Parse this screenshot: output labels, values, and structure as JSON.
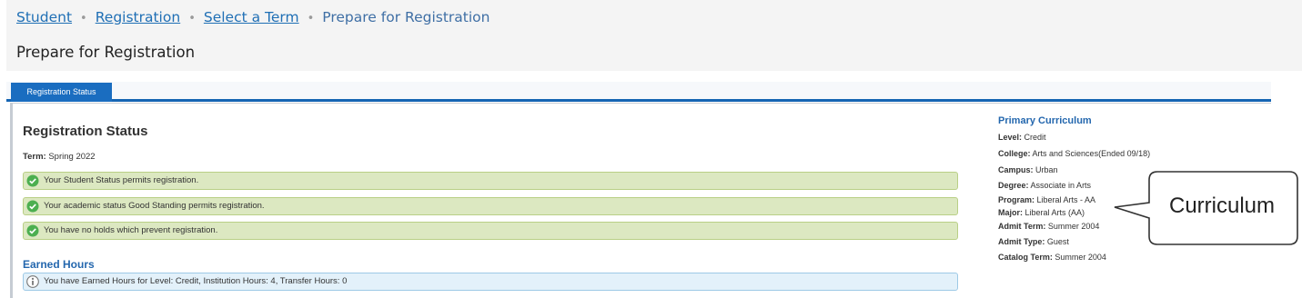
{
  "breadcrumb": {
    "items": [
      "Student",
      "Registration",
      "Select a Term"
    ],
    "separator": "•",
    "current": "Prepare for Registration"
  },
  "page_title": "Prepare for Registration",
  "tabs": [
    {
      "label": "Registration Status",
      "active": true
    }
  ],
  "registration_status": {
    "title": "Registration Status",
    "term_label": "Term:",
    "term_value": "Spring 2022",
    "messages": [
      "Your Student Status permits registration.",
      "Your academic status Good Standing permits registration.",
      "You have no holds which prevent registration."
    ]
  },
  "earned_hours": {
    "title": "Earned Hours",
    "message": "You have Earned Hours for Level: Credit, Institution Hours: 4, Transfer Hours: 0"
  },
  "primary_curriculum": {
    "title": "Primary Curriculum",
    "rows": [
      {
        "label": "Level:",
        "value": "Credit"
      },
      {
        "label": "College:",
        "value": "Arts and Sciences(Ended 09/18)"
      },
      {
        "label": "Campus:",
        "value": "Urban"
      },
      {
        "label": "Degree:",
        "value": "Associate in Arts"
      },
      {
        "label": "Program:",
        "value": "Liberal Arts - AA"
      },
      {
        "label": "Major:",
        "value": "Liberal Arts (AA)"
      },
      {
        "label": "Admit Term:",
        "value": "Summer 2004"
      },
      {
        "label": "Admit Type:",
        "value": "Guest"
      },
      {
        "label": "Catalog Term:",
        "value": "Summer 2004"
      }
    ]
  },
  "callout": {
    "text": "Curriculum"
  },
  "colors": {
    "link": "#1f6fb5",
    "tab_active": "#1a6dc0",
    "success_bg": "#dce8c1",
    "success_icon": "#4caf50",
    "info_bg": "#e3f1fa",
    "section_heading": "#2467ae"
  },
  "icons": {
    "success": "check-circle-icon",
    "info": "info-circle-icon"
  }
}
